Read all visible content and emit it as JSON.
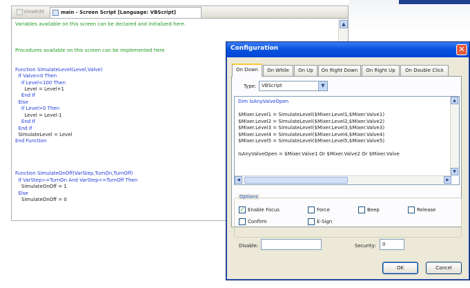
{
  "editor": {
    "tabs": [
      {
        "label": "ViewEdit",
        "active": false
      },
      {
        "label": "main - Screen Script [Language: VBScript]",
        "active": true
      }
    ],
    "code_lines": [
      {
        "text": "Variables available on this screen can be declared and initialized here.",
        "kind": "comment"
      },
      {
        "text": "",
        "kind": "text"
      },
      {
        "text": "",
        "kind": "text"
      },
      {
        "text": "",
        "kind": "text"
      },
      {
        "text": "Procedures available on this screen can be implemented here",
        "kind": "comment"
      },
      {
        "text": "",
        "kind": "text"
      },
      {
        "text": "",
        "kind": "text"
      },
      {
        "text": "Function SimulateLevel(Level,Valve)",
        "kind": "keyword"
      },
      {
        "text": "  If Valve=0 Then",
        "kind": "keyword"
      },
      {
        "text": "    If Level<100 Then",
        "kind": "keyword"
      },
      {
        "text": "      Level = Level+1",
        "kind": "text"
      },
      {
        "text": "    End If",
        "kind": "keyword"
      },
      {
        "text": "  Else",
        "kind": "keyword"
      },
      {
        "text": "    If Level>0 Then",
        "kind": "keyword"
      },
      {
        "text": "      Level = Level-1",
        "kind": "text"
      },
      {
        "text": "    End If",
        "kind": "keyword"
      },
      {
        "text": "  End If",
        "kind": "keyword"
      },
      {
        "text": "  SimulateLevel = Level",
        "kind": "text"
      },
      {
        "text": "End Function",
        "kind": "keyword"
      },
      {
        "text": "",
        "kind": "text"
      },
      {
        "text": "",
        "kind": "text"
      },
      {
        "text": "",
        "kind": "text"
      },
      {
        "text": "",
        "kind": "text"
      },
      {
        "text": "Function SimulateOnOff(VarStep,TurnOn,TurnOff)",
        "kind": "keyword"
      },
      {
        "text": "  If VarStep>=TurnOn And VarStep<=TurnOff Then",
        "kind": "keyword"
      },
      {
        "text": "    SimulateOnOff = 1",
        "kind": "text"
      },
      {
        "text": "  Else",
        "kind": "keyword"
      },
      {
        "text": "    SimulateOnOff = 0",
        "kind": "text"
      }
    ]
  },
  "dialog": {
    "title": "Configuration",
    "close_glyph": "✕",
    "tabs": [
      {
        "label": "On Down",
        "active": true
      },
      {
        "label": "On While",
        "active": false
      },
      {
        "label": "On Up",
        "active": false
      },
      {
        "label": "On Right Down",
        "active": false
      },
      {
        "label": "On Right Up",
        "active": false
      },
      {
        "label": "On Double Click",
        "active": false
      }
    ],
    "type_label": "Type:",
    "type_value": "VBScript",
    "script_lines": [
      "Dim IsAnyValveOpen",
      "",
      "$Mixer.Level1 = SimulateLevel($Mixer.Level1,$Mixer.Valve1)",
      "$Mixer.Level2 = SimulateLevel($Mixer.Level2,$Mixer.Valve2)",
      "$Mixer.Level3 = SimulateLevel($Mixer.Level3,$Mixer.Valve3)",
      "$Mixer.Level4 = SimulateLevel($Mixer.Level4,$Mixer.Valve4)",
      "$Mixer.Level5 = SimulateLevel($Mixer.Level5,$Mixer.Valve5)",
      "",
      "IsAnyValveOpen = $Mixer.Valve1 Or $Mixer.Valve2 Or $Mixer.Valve"
    ],
    "options": {
      "legend": "Options",
      "checkboxes": [
        {
          "label": "Enable Focus",
          "checked": true
        },
        {
          "label": "Force",
          "checked": false
        },
        {
          "label": "Beep",
          "checked": false
        },
        {
          "label": "Release",
          "checked": false
        },
        {
          "label": "Confirm",
          "checked": false
        },
        {
          "label": "E-Sign",
          "checked": false
        }
      ]
    },
    "disable_label": "Disable:",
    "disable_value": "",
    "security_label": "Security:",
    "security_value": "0",
    "ok_label": "OK",
    "cancel_label": "Cancel"
  },
  "colors": {
    "comment": "#1e9a1e",
    "keyword": "#1f3ad9",
    "titlebar": "#0a55e0"
  }
}
